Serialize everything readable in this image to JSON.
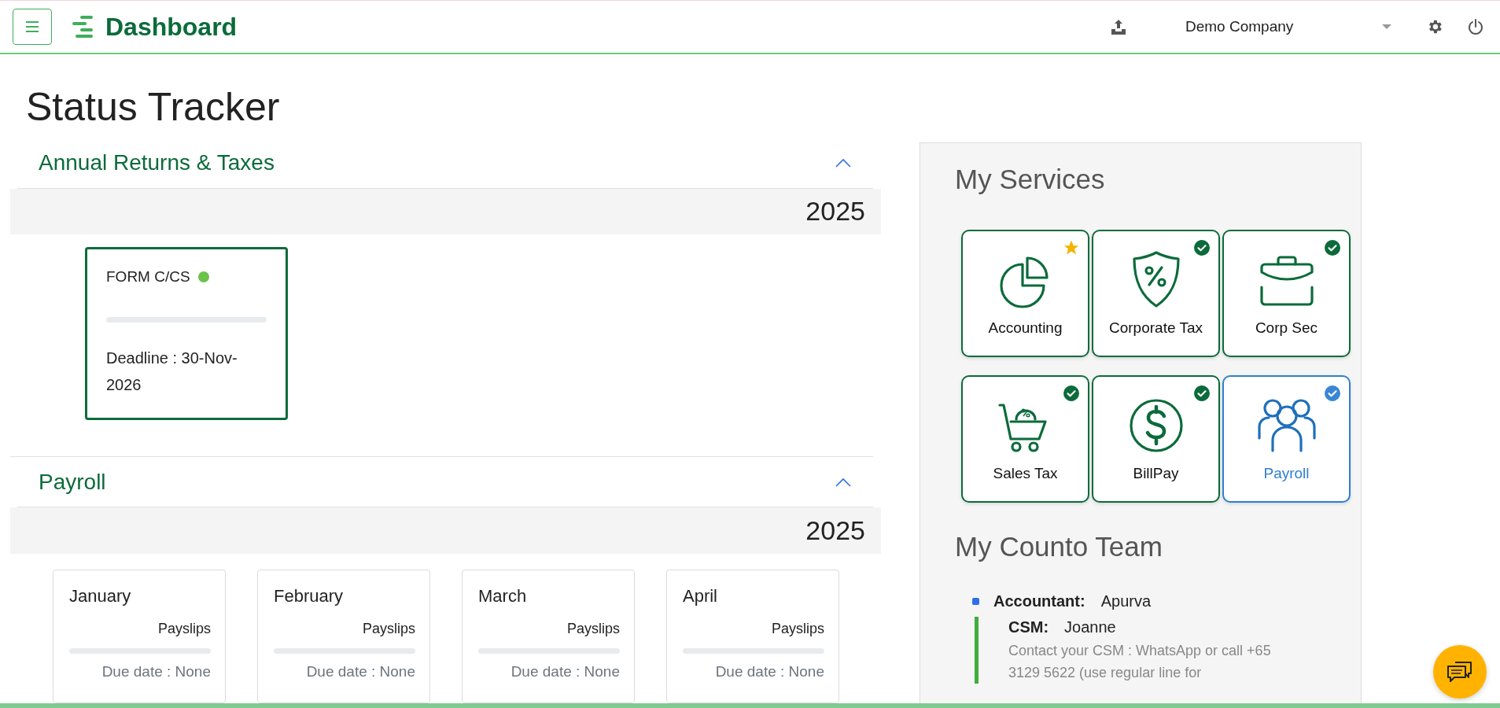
{
  "header": {
    "brand": "Dashboard",
    "company": "Demo Company"
  },
  "title": "Status Tracker",
  "sections": [
    {
      "title": "Annual Returns & Taxes",
      "expanded": true,
      "year": "2025",
      "kind": "forms",
      "cards": [
        {
          "name": "FORM C/CS",
          "color": "#6cc24a",
          "level": 0,
          "deadline": "Deadline : 30-Nov-2026"
        }
      ]
    },
    {
      "title": "Payroll",
      "expanded": true,
      "year": "2025",
      "kind": "months",
      "cards": [
        {
          "name": "January",
          "task": "Payslips",
          "level": 0,
          "deadline": "Due date : None"
        },
        {
          "name": "February",
          "task": "Payslips",
          "level": 0,
          "deadline": "Due date : None"
        },
        {
          "name": "March",
          "task": "Payslips",
          "level": 0,
          "deadline": "Due date : None"
        },
        {
          "name": "April",
          "task": "Payslips",
          "level": 0,
          "deadline": "Due date : None"
        }
      ]
    }
  ],
  "services": {
    "title": "My Services",
    "items": [
      {
        "label": "Accounting",
        "kind": "pie",
        "starred": true,
        "checked": false,
        "selected": false
      },
      {
        "label": "Corporate Tax",
        "kind": "shield",
        "starred": false,
        "checked": true,
        "selected": false
      },
      {
        "label": "Corp Sec",
        "kind": "briefcase",
        "starred": false,
        "checked": true,
        "selected": false
      },
      {
        "label": "Sales Tax",
        "kind": "cart",
        "starred": false,
        "checked": true,
        "selected": false
      },
      {
        "label": "BillPay",
        "kind": "dollar",
        "starred": false,
        "checked": true,
        "selected": false
      },
      {
        "label": "Payroll",
        "kind": "people",
        "starred": false,
        "checked": true,
        "selected": true
      }
    ]
  },
  "team": {
    "title": "My Counto Team",
    "members": [
      {
        "role": "Accountant:",
        "name": "Apurva",
        "color": "#2f6fe6",
        "children": [
          {
            "role": "CSM:",
            "name": "Joanne",
            "note": "Contact your CSM : WhatsApp or call +65 3129 5622 (use regular line for"
          }
        ]
      }
    ]
  }
}
